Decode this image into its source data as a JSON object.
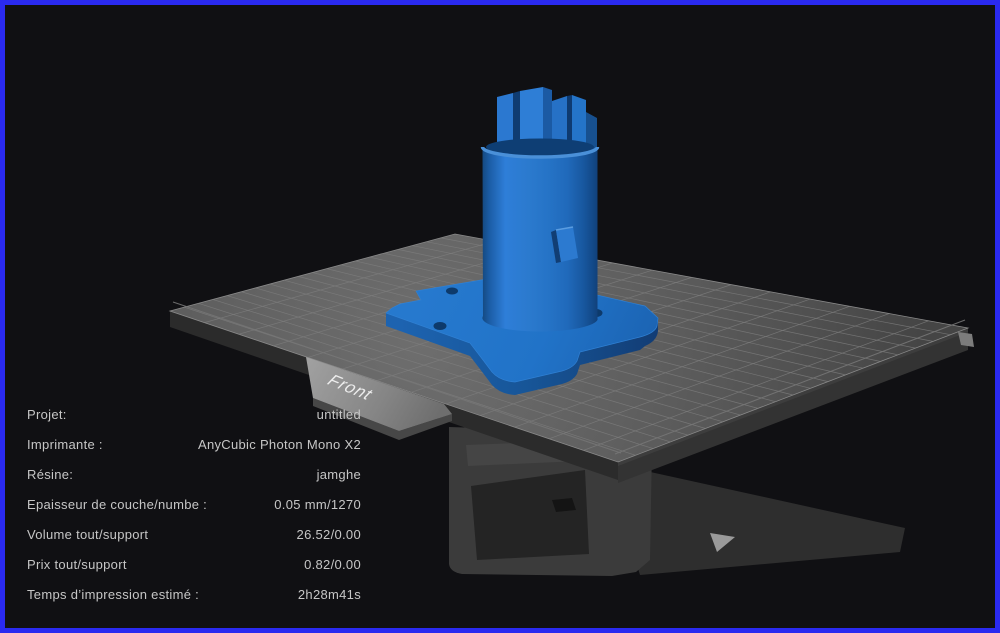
{
  "window": {
    "border_color": "#2a2af0",
    "background_color": "#101013"
  },
  "viewport": {
    "front_label": "Front",
    "model_color": "#2575c9",
    "plate_color": "#5d5d5d",
    "grid_line_color": "#7e7e7e"
  },
  "info_panel": {
    "rows": [
      {
        "label": "Projet:",
        "value": "untitled"
      },
      {
        "label": "Imprimante :",
        "value": "AnyCubic Photon Mono X2"
      },
      {
        "label": "Résine:",
        "value": "jamghe"
      },
      {
        "label": "Epaisseur de couche/numbe :",
        "value": "0.05 mm/1270"
      },
      {
        "label": "Volume tout/support",
        "value": "26.52/0.00"
      },
      {
        "label": "Prix tout/support",
        "value": "0.82/0.00"
      },
      {
        "label": "Temps d’impression estimé :",
        "value": "2h28m41s"
      }
    ]
  }
}
